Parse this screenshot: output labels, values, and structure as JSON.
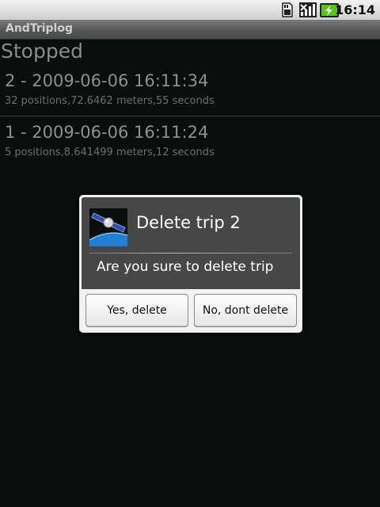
{
  "status_bar": {
    "time": "16:14",
    "icons": [
      "sd-card-icon",
      "signal-icon",
      "battery-charging-icon"
    ]
  },
  "app": {
    "title": "AndTriplog",
    "state": "Stopped"
  },
  "trips": [
    {
      "title": "2 - 2009-06-06 16:11:34",
      "detail": "32 positions,72.6462 meters,55 seconds"
    },
    {
      "title": "1 - 2009-06-06 16:11:24",
      "detail": "5 positions,8.641499 meters,12 seconds"
    }
  ],
  "dialog": {
    "icon": "satellite-icon",
    "title": "Delete trip 2",
    "message": "Are you sure to delete trip",
    "confirm_label": "Yes, delete",
    "cancel_label": "No, dont delete"
  },
  "colors": {
    "background": "#0a0e0c",
    "dialog_body": "#474747",
    "dialog_frame": "#f2f2f2"
  }
}
